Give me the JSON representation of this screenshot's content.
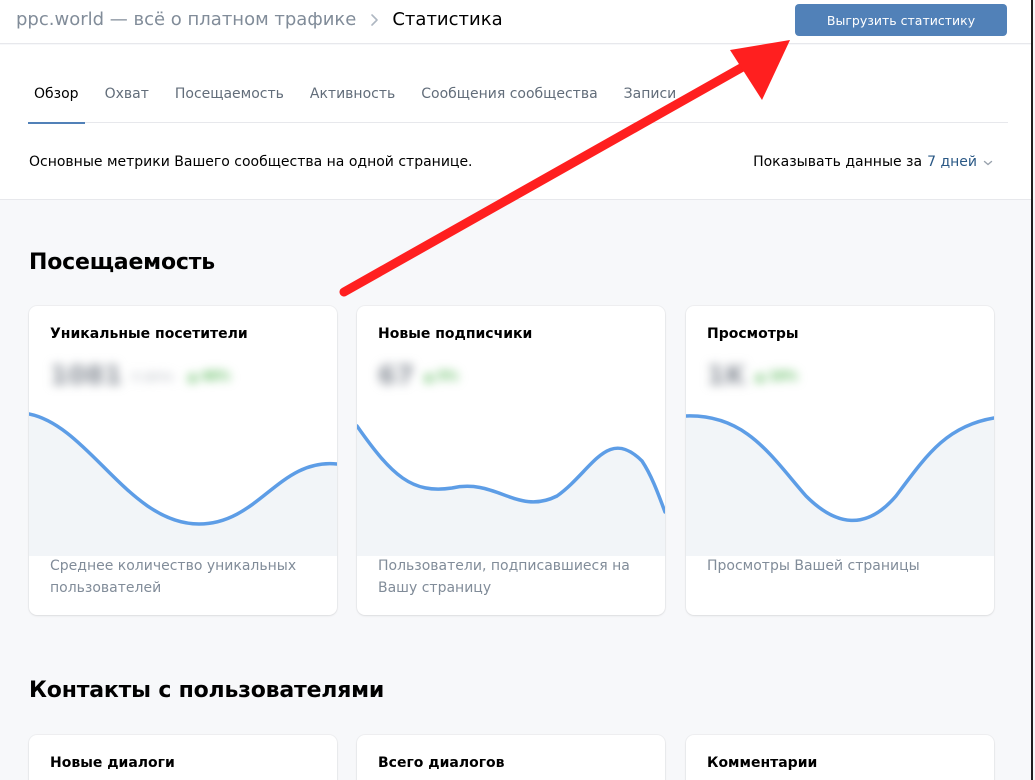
{
  "header": {
    "community_name": "ppc.world — всё о платном трафике",
    "current_page": "Статистика",
    "export_button": "Выгрузить статистику"
  },
  "tabs": [
    {
      "label": "Обзор",
      "active": true
    },
    {
      "label": "Охват",
      "active": false
    },
    {
      "label": "Посещаемость",
      "active": false
    },
    {
      "label": "Активность",
      "active": false
    },
    {
      "label": "Сообщения сообщества",
      "active": false
    },
    {
      "label": "Записи",
      "active": false
    }
  ],
  "description": "Основные метрики Вашего сообщества на одной странице.",
  "period": {
    "label": "Показывать данные за",
    "value": "7 дней"
  },
  "sections": {
    "attendance": {
      "title": "Посещаемость",
      "cards": [
        {
          "title": "Уникальные посетители",
          "description": "Среднее количество уникальных пользователей"
        },
        {
          "title": "Новые подписчики",
          "description": "Пользователи, подписавшиеся на Вашу страницу"
        },
        {
          "title": "Просмотры",
          "description": "Просмотры Вашей страницы"
        }
      ]
    },
    "contacts": {
      "title": "Контакты с пользователями",
      "cards": [
        {
          "title": "Новые диалоги"
        },
        {
          "title": "Всего диалогов"
        },
        {
          "title": "Комментарии"
        }
      ]
    }
  },
  "colors": {
    "accent": "#5181b8",
    "chart_line": "#5d9de6",
    "chart_fill": "#f2f5f8",
    "arrow": "#ff1f1f"
  }
}
